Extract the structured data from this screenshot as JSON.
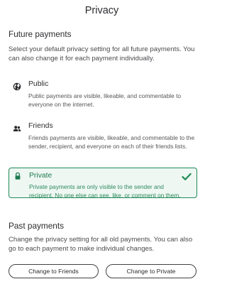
{
  "header": {
    "title": "Privacy"
  },
  "future": {
    "heading": "Future payments",
    "description": "Select your default privacy setting for all future payments. You can also change it for each payment individually.",
    "options": [
      {
        "icon": "globe-icon",
        "title": "Public",
        "description": "Public payments are visible, likeable, and commentable to everyone on the internet.",
        "selected": false
      },
      {
        "icon": "people-icon",
        "title": "Friends",
        "description": "Friends payments are visible, likeable, and commentable to the sender, recipient, and everyone on each of their friends lists.",
        "selected": false
      },
      {
        "icon": "lock-icon",
        "title": "Private",
        "description": "Private payments are only visible to the sender and recipient. No one else can see, like, or comment on them.",
        "selected": true
      }
    ]
  },
  "past": {
    "heading": "Past payments",
    "description": "Change the privacy setting for all old payments. You can also go to each payment to make individual changes.",
    "buttons": {
      "friends": "Change to Friends",
      "private": "Change to Private"
    }
  },
  "colors": {
    "accent_green": "#1f8a58",
    "selected_bg": "#eef7f2"
  }
}
